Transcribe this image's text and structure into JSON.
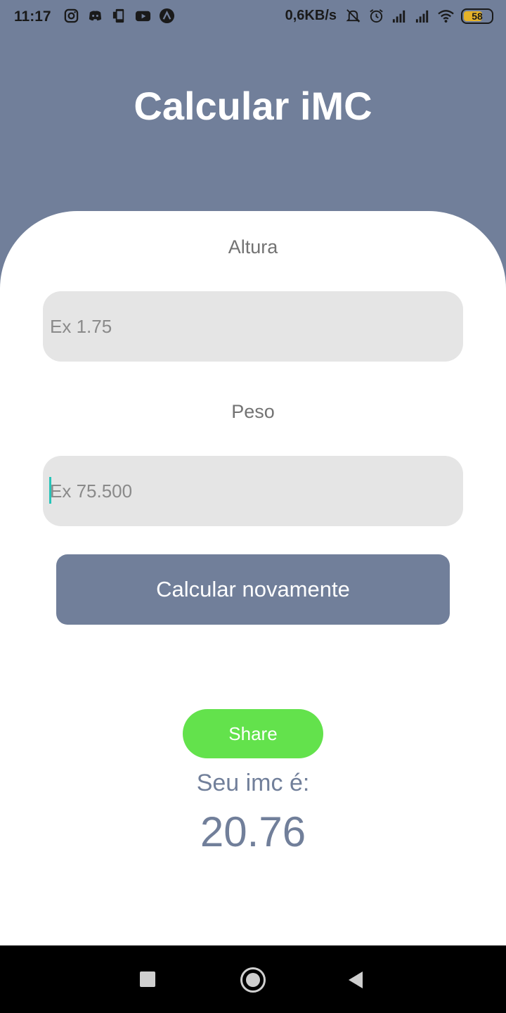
{
  "status_bar": {
    "time": "11:17",
    "network_speed": "0,6KB/s",
    "battery": "58",
    "left_icons": [
      "instagram-icon",
      "discord-icon",
      "phone-app-icon",
      "youtube-icon",
      "a-circle-icon"
    ],
    "right_icons": [
      "mute-bell-icon",
      "alarm-icon",
      "signal-icon",
      "signal-icon",
      "wifi-icon",
      "battery-icon"
    ]
  },
  "header": {
    "title": "Calcular iMC"
  },
  "form": {
    "height_label": "Altura",
    "height_placeholder": "Ex 1.75",
    "weight_label": "Peso",
    "weight_placeholder": "Ex 75.500",
    "calculate_button": "Calcular novamente"
  },
  "result": {
    "share_button": "Share",
    "label": "Seu imc é:",
    "value": "20.76"
  },
  "nav_bar": {
    "icons": [
      "recent-apps-icon",
      "home-icon",
      "back-icon"
    ]
  },
  "colors": {
    "primary": "#717f9a",
    "share_green": "#63e24c",
    "input_bg": "#e5e5e5",
    "caret": "#27c4b8"
  }
}
